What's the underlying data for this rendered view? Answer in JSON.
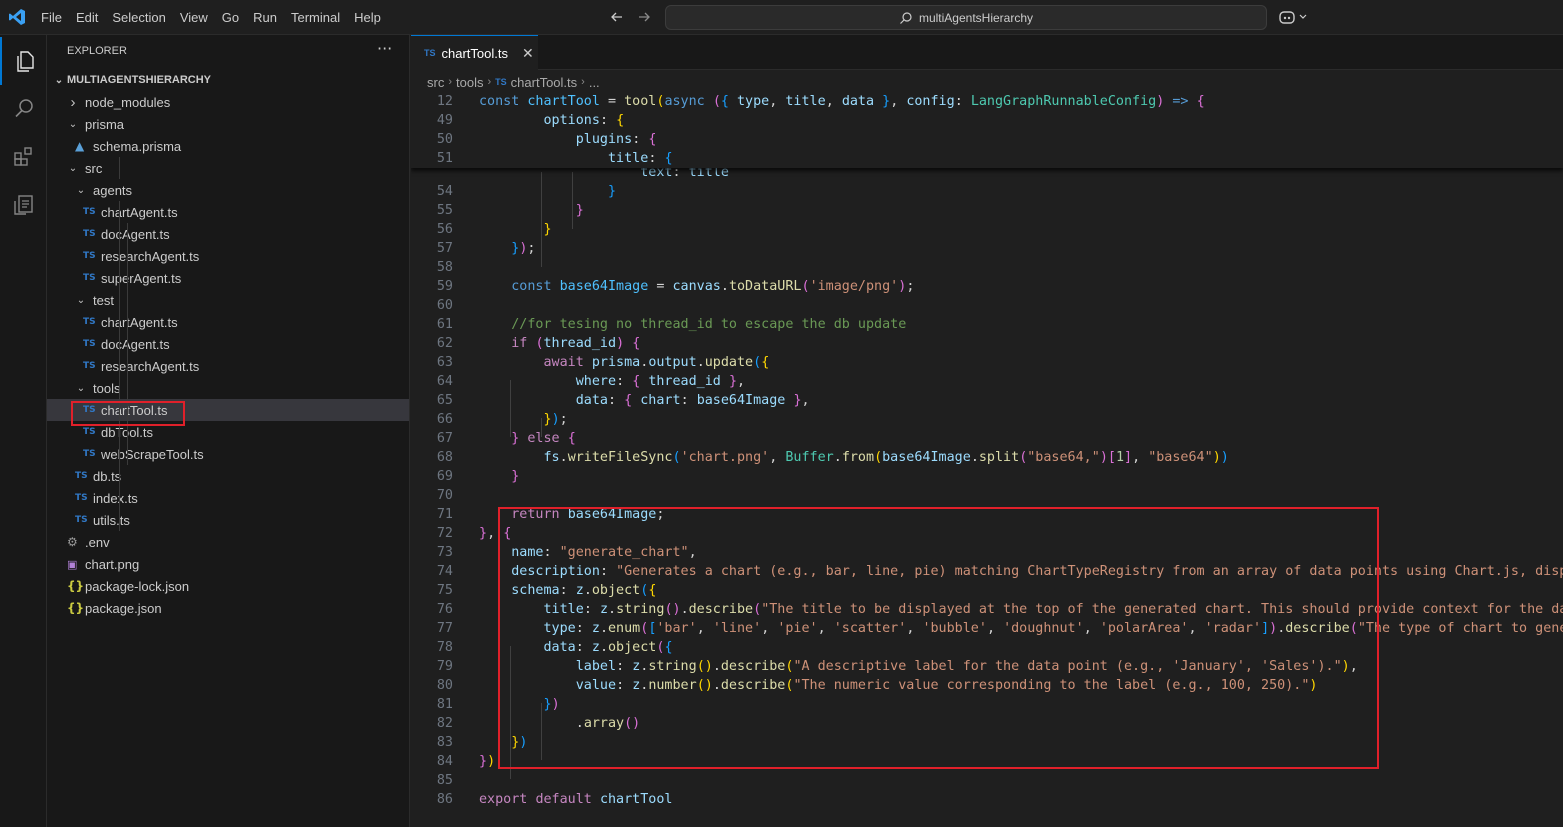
{
  "menu": [
    "File",
    "Edit",
    "Selection",
    "View",
    "Go",
    "Run",
    "Terminal",
    "Help"
  ],
  "command_center": {
    "label": "multiAgentsHierarchy"
  },
  "explorer": {
    "title": "EXPLORER",
    "more": "···",
    "root": "MULTIAGENTSHIERARCHY",
    "items": [
      {
        "label": "node_modules",
        "kind": "folder",
        "state": "collapsed",
        "depth": 1
      },
      {
        "label": "prisma",
        "kind": "folder",
        "state": "expanded",
        "depth": 1
      },
      {
        "label": "schema.prisma",
        "kind": "prisma",
        "depth": 2
      },
      {
        "label": "src",
        "kind": "folder",
        "state": "expanded",
        "depth": 1
      },
      {
        "label": "agents",
        "kind": "folder",
        "state": "expanded",
        "depth": 2
      },
      {
        "label": "chartAgent.ts",
        "kind": "ts",
        "depth": 3
      },
      {
        "label": "docAgent.ts",
        "kind": "ts",
        "depth": 3
      },
      {
        "label": "researchAgent.ts",
        "kind": "ts",
        "depth": 3
      },
      {
        "label": "superAgent.ts",
        "kind": "ts",
        "depth": 3
      },
      {
        "label": "test",
        "kind": "folder",
        "state": "expanded",
        "depth": 2
      },
      {
        "label": "chartAgent.ts",
        "kind": "ts",
        "depth": 3
      },
      {
        "label": "docAgent.ts",
        "kind": "ts",
        "depth": 3
      },
      {
        "label": "researchAgent.ts",
        "kind": "ts",
        "depth": 3
      },
      {
        "label": "tools",
        "kind": "folder",
        "state": "expanded",
        "depth": 2
      },
      {
        "label": "chartTool.ts",
        "kind": "ts",
        "depth": 3,
        "selected": true
      },
      {
        "label": "dbTool.ts",
        "kind": "ts",
        "depth": 3
      },
      {
        "label": "webScrapeTool.ts",
        "kind": "ts",
        "depth": 3
      },
      {
        "label": "db.ts",
        "kind": "ts",
        "depth": 2
      },
      {
        "label": "index.ts",
        "kind": "ts",
        "depth": 2
      },
      {
        "label": "utils.ts",
        "kind": "ts",
        "depth": 2
      },
      {
        "label": ".env",
        "kind": "env",
        "depth": 1
      },
      {
        "label": "chart.png",
        "kind": "img",
        "depth": 1
      },
      {
        "label": "package-lock.json",
        "kind": "json",
        "depth": 1
      },
      {
        "label": "package.json",
        "kind": "json",
        "depth": 1
      }
    ]
  },
  "tab": {
    "badge": "TS",
    "label": "chartTool.ts",
    "close": "✕"
  },
  "breadcrumbs": [
    "src",
    "tools",
    "chartTool.ts",
    "..."
  ],
  "breadcrumb_badge": "TS",
  "sticky_lines": [
    {
      "n": "12",
      "tokens": [
        [
          "k",
          "const "
        ],
        [
          "c",
          "chartTool"
        ],
        [
          "p",
          " = "
        ],
        [
          "f",
          "tool"
        ],
        [
          "b1",
          "("
        ],
        [
          "k",
          "async "
        ],
        [
          "b2",
          "("
        ],
        [
          "b3",
          "{ "
        ],
        [
          "v",
          "type"
        ],
        [
          "p",
          ", "
        ],
        [
          "v",
          "title"
        ],
        [
          "p",
          ", "
        ],
        [
          "v",
          "data "
        ],
        [
          "b3",
          "}"
        ],
        [
          "p",
          ", "
        ],
        [
          "v",
          "config"
        ],
        [
          "p",
          ": "
        ],
        [
          "t",
          "LangGraphRunnableConfig"
        ],
        [
          "b2",
          ")"
        ],
        [
          "k",
          " => "
        ],
        [
          "b2",
          "{"
        ]
      ]
    },
    {
      "n": "49",
      "tokens": [
        [
          "p",
          "        "
        ],
        [
          "v",
          "options"
        ],
        [
          "p",
          ": "
        ],
        [
          "b1",
          "{"
        ]
      ]
    },
    {
      "n": "50",
      "tokens": [
        [
          "p",
          "            "
        ],
        [
          "v",
          "plugins"
        ],
        [
          "p",
          ": "
        ],
        [
          "b2",
          "{"
        ]
      ]
    },
    {
      "n": "51",
      "tokens": [
        [
          "p",
          "                "
        ],
        [
          "v",
          "title"
        ],
        [
          "p",
          ": "
        ],
        [
          "b3",
          "{"
        ]
      ]
    }
  ],
  "code_lines": [
    {
      "n": "",
      "tokens": [
        [
          "p",
          "                    "
        ],
        [
          "v",
          "text"
        ],
        [
          "p",
          ": "
        ],
        [
          "v",
          "title"
        ]
      ]
    },
    {
      "n": "54",
      "tokens": [
        [
          "p",
          "                "
        ],
        [
          "b3",
          "}"
        ]
      ]
    },
    {
      "n": "55",
      "tokens": [
        [
          "p",
          "            "
        ],
        [
          "b2",
          "}"
        ]
      ]
    },
    {
      "n": "56",
      "tokens": [
        [
          "p",
          "        "
        ],
        [
          "b1",
          "}"
        ]
      ]
    },
    {
      "n": "57",
      "tokens": [
        [
          "p",
          "    "
        ],
        [
          "b3",
          "}"
        ],
        [
          "b2",
          ")"
        ],
        [
          "p",
          ";"
        ]
      ]
    },
    {
      "n": "58",
      "tokens": []
    },
    {
      "n": "59",
      "tokens": [
        [
          "p",
          "    "
        ],
        [
          "k",
          "const "
        ],
        [
          "c",
          "base64Image"
        ],
        [
          "p",
          " = "
        ],
        [
          "v",
          "canvas"
        ],
        [
          "p",
          "."
        ],
        [
          "f",
          "toDataURL"
        ],
        [
          "b2",
          "("
        ],
        [
          "s",
          "'image/png'"
        ],
        [
          "b2",
          ")"
        ],
        [
          "p",
          ";"
        ]
      ]
    },
    {
      "n": "60",
      "tokens": []
    },
    {
      "n": "61",
      "tokens": [
        [
          "p",
          "    "
        ],
        [
          "cm",
          "//for tesing no thread_id to escape the db update"
        ]
      ]
    },
    {
      "n": "62",
      "tokens": [
        [
          "p",
          "    "
        ],
        [
          "kc",
          "if "
        ],
        [
          "b2",
          "("
        ],
        [
          "v",
          "thread_id"
        ],
        [
          "b2",
          ") "
        ],
        [
          "b2",
          "{"
        ]
      ]
    },
    {
      "n": "63",
      "tokens": [
        [
          "p",
          "        "
        ],
        [
          "kc",
          "await "
        ],
        [
          "v",
          "prisma"
        ],
        [
          "p",
          "."
        ],
        [
          "v",
          "output"
        ],
        [
          "p",
          "."
        ],
        [
          "f",
          "update"
        ],
        [
          "b3",
          "("
        ],
        [
          "b1",
          "{"
        ]
      ]
    },
    {
      "n": "64",
      "tokens": [
        [
          "p",
          "            "
        ],
        [
          "v",
          "where"
        ],
        [
          "p",
          ": "
        ],
        [
          "b2",
          "{ "
        ],
        [
          "v",
          "thread_id "
        ],
        [
          "b2",
          "}"
        ],
        [
          "p",
          ","
        ]
      ]
    },
    {
      "n": "65",
      "tokens": [
        [
          "p",
          "            "
        ],
        [
          "v",
          "data"
        ],
        [
          "p",
          ": "
        ],
        [
          "b2",
          "{ "
        ],
        [
          "v",
          "chart"
        ],
        [
          "p",
          ": "
        ],
        [
          "v",
          "base64Image "
        ],
        [
          "b2",
          "}"
        ],
        [
          "p",
          ","
        ]
      ]
    },
    {
      "n": "66",
      "tokens": [
        [
          "p",
          "        "
        ],
        [
          "b1",
          "}"
        ],
        [
          "b3",
          ")"
        ],
        [
          "p",
          ";"
        ]
      ]
    },
    {
      "n": "67",
      "tokens": [
        [
          "p",
          "    "
        ],
        [
          "b2",
          "} "
        ],
        [
          "kc",
          "else "
        ],
        [
          "b2",
          "{"
        ]
      ]
    },
    {
      "n": "68",
      "tokens": [
        [
          "p",
          "        "
        ],
        [
          "v",
          "fs"
        ],
        [
          "p",
          "."
        ],
        [
          "f",
          "writeFileSync"
        ],
        [
          "b3",
          "("
        ],
        [
          "s",
          "'chart.png'"
        ],
        [
          "p",
          ", "
        ],
        [
          "t",
          "Buffer"
        ],
        [
          "p",
          "."
        ],
        [
          "f",
          "from"
        ],
        [
          "b1",
          "("
        ],
        [
          "v",
          "base64Image"
        ],
        [
          "p",
          "."
        ],
        [
          "f",
          "split"
        ],
        [
          "b2",
          "("
        ],
        [
          "s",
          "\"base64,\""
        ],
        [
          "b2",
          ")"
        ],
        [
          "b2",
          "["
        ],
        [
          "n",
          "1"
        ],
        [
          "b2",
          "]"
        ],
        [
          "p",
          ", "
        ],
        [
          "s",
          "\"base64\""
        ],
        [
          "b1",
          ")"
        ],
        [
          "b3",
          ")"
        ]
      ]
    },
    {
      "n": "69",
      "tokens": [
        [
          "p",
          "    "
        ],
        [
          "b2",
          "}"
        ]
      ]
    },
    {
      "n": "70",
      "tokens": []
    },
    {
      "n": "71",
      "tokens": [
        [
          "p",
          "    "
        ],
        [
          "kc",
          "return "
        ],
        [
          "v",
          "base64Image"
        ],
        [
          "p",
          ";"
        ]
      ]
    },
    {
      "n": "72",
      "tokens": [
        [
          "b2",
          "}"
        ],
        [
          "p",
          ", "
        ],
        [
          "b2",
          "{"
        ]
      ]
    },
    {
      "n": "73",
      "tokens": [
        [
          "p",
          "    "
        ],
        [
          "v",
          "name"
        ],
        [
          "p",
          ": "
        ],
        [
          "s",
          "\"generate_chart\""
        ],
        [
          "p",
          ","
        ]
      ]
    },
    {
      "n": "74",
      "tokens": [
        [
          "p",
          "    "
        ],
        [
          "v",
          "description"
        ],
        [
          "p",
          ": "
        ],
        [
          "s",
          "\"Generates a chart (e.g., bar, line, pie) matching ChartTypeRegistry from an array of data points using Chart.js, displaying"
        ]
      ]
    },
    {
      "n": "75",
      "tokens": [
        [
          "p",
          "    "
        ],
        [
          "v",
          "schema"
        ],
        [
          "p",
          ": "
        ],
        [
          "v",
          "z"
        ],
        [
          "p",
          "."
        ],
        [
          "f",
          "object"
        ],
        [
          "b3",
          "("
        ],
        [
          "b1",
          "{"
        ]
      ]
    },
    {
      "n": "76",
      "tokens": [
        [
          "p",
          "        "
        ],
        [
          "v",
          "title"
        ],
        [
          "p",
          ": "
        ],
        [
          "v",
          "z"
        ],
        [
          "p",
          "."
        ],
        [
          "f",
          "string"
        ],
        [
          "b2",
          "()"
        ],
        [
          "p",
          "."
        ],
        [
          "f",
          "describe"
        ],
        [
          "b2",
          "("
        ],
        [
          "s",
          "\"The title to be displayed at the top of the generated chart. This should provide context for the data pre"
        ]
      ]
    },
    {
      "n": "77",
      "tokens": [
        [
          "p",
          "        "
        ],
        [
          "v",
          "type"
        ],
        [
          "p",
          ": "
        ],
        [
          "v",
          "z"
        ],
        [
          "p",
          "."
        ],
        [
          "f",
          "enum"
        ],
        [
          "b2",
          "("
        ],
        [
          "b3",
          "["
        ],
        [
          "s",
          "'bar'"
        ],
        [
          "p",
          ", "
        ],
        [
          "s",
          "'line'"
        ],
        [
          "p",
          ", "
        ],
        [
          "s",
          "'pie'"
        ],
        [
          "p",
          ", "
        ],
        [
          "s",
          "'scatter'"
        ],
        [
          "p",
          ", "
        ],
        [
          "s",
          "'bubble'"
        ],
        [
          "p",
          ", "
        ],
        [
          "s",
          "'doughnut'"
        ],
        [
          "p",
          ", "
        ],
        [
          "s",
          "'polarArea'"
        ],
        [
          "p",
          ", "
        ],
        [
          "s",
          "'radar'"
        ],
        [
          "b3",
          "]"
        ],
        [
          "b2",
          ")"
        ],
        [
          "p",
          "."
        ],
        [
          "f",
          "describe"
        ],
        [
          "b2",
          "("
        ],
        [
          "s",
          "\"The type of chart to generate."
        ]
      ]
    },
    {
      "n": "78",
      "tokens": [
        [
          "p",
          "        "
        ],
        [
          "v",
          "data"
        ],
        [
          "p",
          ": "
        ],
        [
          "v",
          "z"
        ],
        [
          "p",
          "."
        ],
        [
          "f",
          "object"
        ],
        [
          "b2",
          "("
        ],
        [
          "b3",
          "{"
        ]
      ]
    },
    {
      "n": "79",
      "tokens": [
        [
          "p",
          "            "
        ],
        [
          "v",
          "label"
        ],
        [
          "p",
          ": "
        ],
        [
          "v",
          "z"
        ],
        [
          "p",
          "."
        ],
        [
          "f",
          "string"
        ],
        [
          "b1",
          "()"
        ],
        [
          "p",
          "."
        ],
        [
          "f",
          "describe"
        ],
        [
          "b1",
          "("
        ],
        [
          "s",
          "\"A descriptive label for the data point (e.g., 'January', 'Sales').\""
        ],
        [
          "b1",
          ")"
        ],
        [
          "p",
          ","
        ]
      ]
    },
    {
      "n": "80",
      "tokens": [
        [
          "p",
          "            "
        ],
        [
          "v",
          "value"
        ],
        [
          "p",
          ": "
        ],
        [
          "v",
          "z"
        ],
        [
          "p",
          "."
        ],
        [
          "f",
          "number"
        ],
        [
          "b1",
          "()"
        ],
        [
          "p",
          "."
        ],
        [
          "f",
          "describe"
        ],
        [
          "b1",
          "("
        ],
        [
          "s",
          "\"The numeric value corresponding to the label (e.g., 100, 250).\""
        ],
        [
          "b1",
          ")"
        ]
      ]
    },
    {
      "n": "81",
      "tokens": [
        [
          "p",
          "        "
        ],
        [
          "b3",
          "}"
        ],
        [
          "b2",
          ")"
        ]
      ]
    },
    {
      "n": "82",
      "tokens": [
        [
          "p",
          "            ."
        ],
        [
          "f",
          "array"
        ],
        [
          "b2",
          "()"
        ]
      ]
    },
    {
      "n": "83",
      "tokens": [
        [
          "p",
          "    "
        ],
        [
          "b1",
          "}"
        ],
        [
          "b3",
          ")"
        ]
      ]
    },
    {
      "n": "84",
      "tokens": [
        [
          "b2",
          "}"
        ],
        [
          "b1",
          ")"
        ]
      ]
    },
    {
      "n": "85",
      "tokens": []
    },
    {
      "n": "86",
      "tokens": [
        [
          "kc",
          "export "
        ],
        [
          "kc",
          "default "
        ],
        [
          "v",
          "chartTool"
        ]
      ]
    }
  ],
  "colors": {
    "accent": "#0078d4",
    "highlight": "#e0202a"
  },
  "icons": [
    "vscode-logo-icon",
    "explorer-icon",
    "search-icon",
    "extensions-icon",
    "remote-explorer-icon",
    "copilot-icon"
  ]
}
